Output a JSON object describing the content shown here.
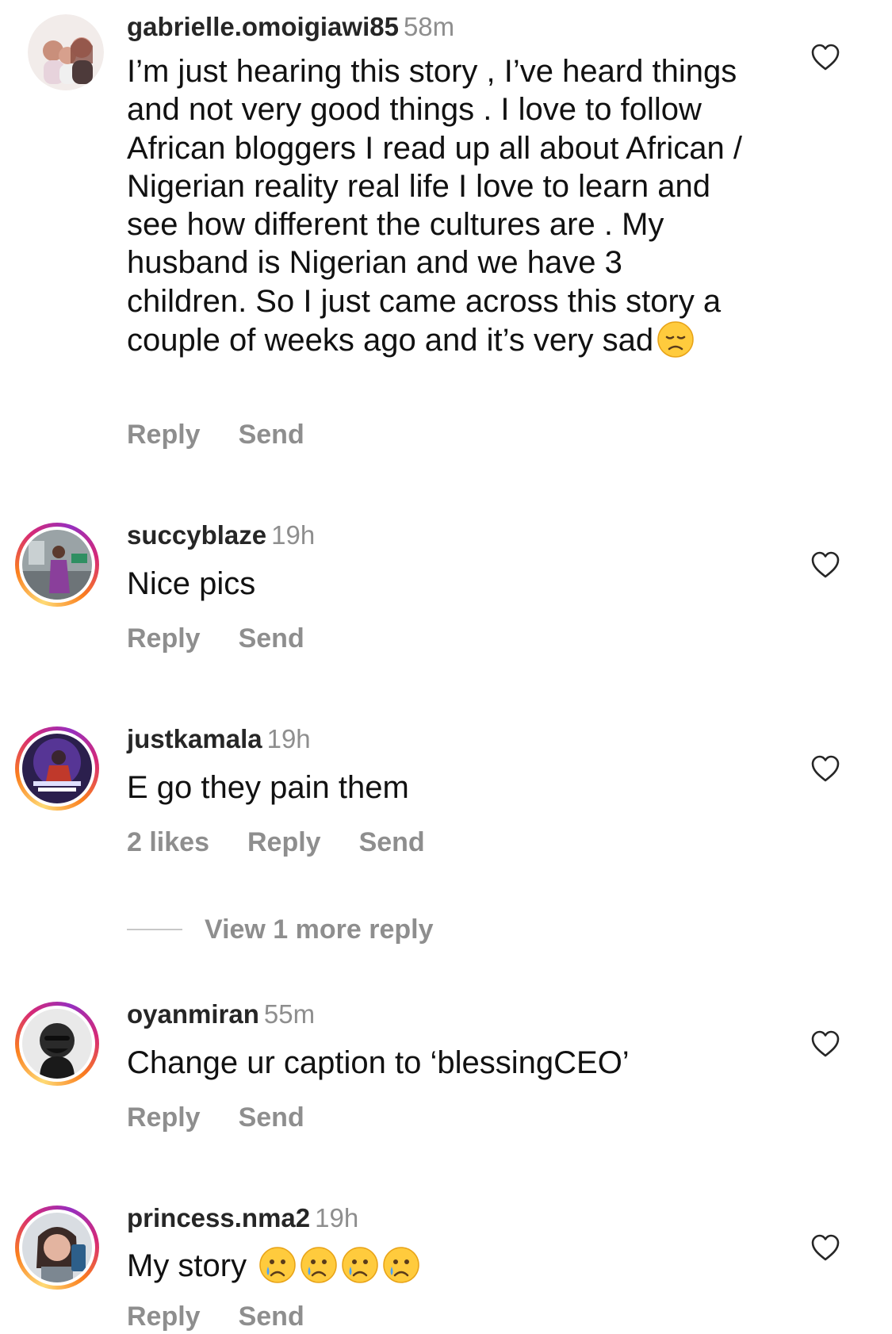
{
  "comments": [
    {
      "username": "gabrielle.omoigiawi85",
      "time": "58m",
      "text": "I’m just hearing this story , I’ve heard things and not very good things . I love to follow African bloggers I read up all about African / Nigerian reality real life I love to learn and see how different the cultures are . My husband is Nigerian and we have 3 children. So I just came across this story a couple of weeks ago and it’s very sad",
      "emoji": "disappointed-face",
      "reply": "Reply",
      "send": "Send"
    },
    {
      "username": "succyblaze",
      "time": "19h",
      "text": "Nice pics",
      "reply": "Reply",
      "send": "Send"
    },
    {
      "username": "justkamala",
      "time": "19h",
      "text": "E go they pain them",
      "likes": "2 likes",
      "reply": "Reply",
      "send": "Send",
      "view_replies": "View 1 more reply"
    },
    {
      "username": "oyanmiran",
      "time": "55m",
      "text": "Change ur caption to ‘blessingCEO’",
      "reply": "Reply",
      "send": "Send"
    },
    {
      "username": "princess.nma2",
      "time": "19h",
      "text": "My story",
      "emoji": "crying-face",
      "emoji_count": 4,
      "reply": "Reply",
      "send": "Send"
    }
  ],
  "colors": {
    "text": "#262626",
    "secondary": "#8e8e8e",
    "story_ring": [
      "#feda75",
      "#fa7e1e",
      "#d62976",
      "#962fbf"
    ]
  },
  "icons": {
    "like": "heart-outline-icon"
  }
}
